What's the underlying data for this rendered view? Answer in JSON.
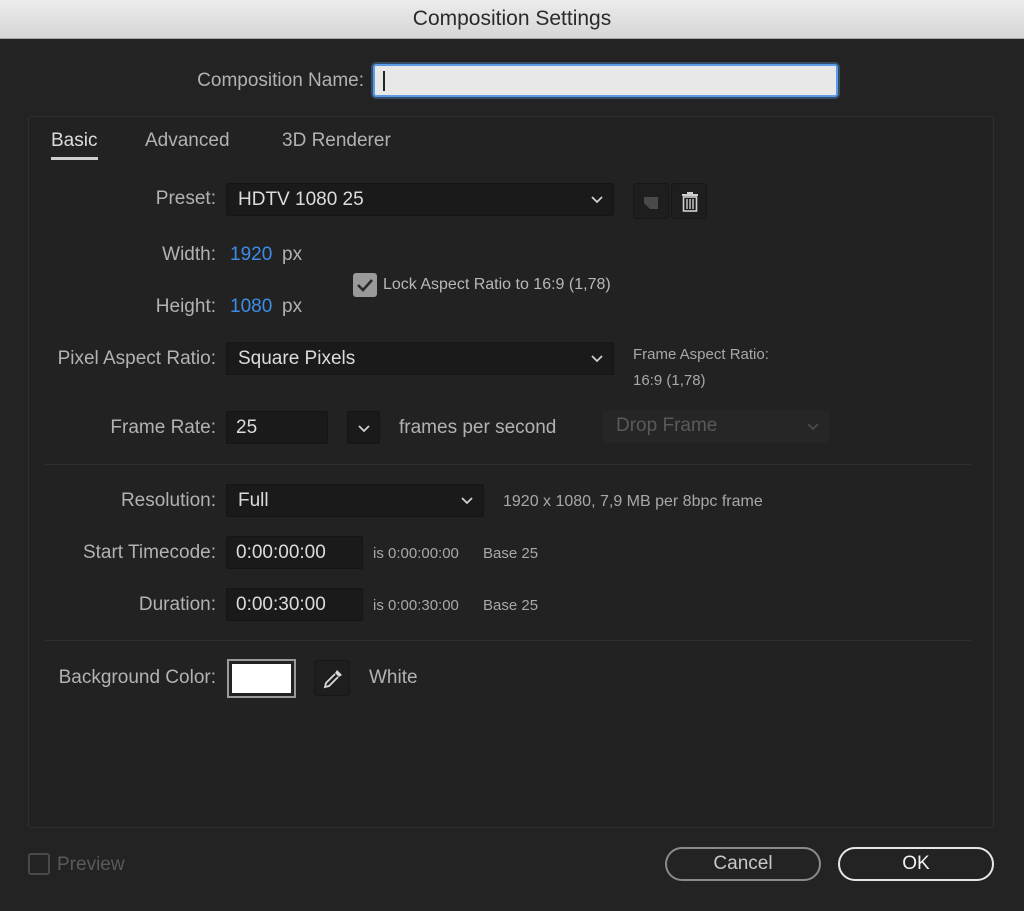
{
  "window": {
    "title": "Composition Settings"
  },
  "comp_name": {
    "label": "Composition Name:",
    "value": ""
  },
  "tabs": [
    {
      "label": "Basic",
      "active": true
    },
    {
      "label": "Advanced",
      "active": false
    },
    {
      "label": "3D Renderer",
      "active": false
    }
  ],
  "preset": {
    "label": "Preset:",
    "value": "HDTV 1080 25",
    "icons": [
      "save-preset-icon",
      "trash-icon"
    ]
  },
  "width": {
    "label": "Width:",
    "value": "1920",
    "unit": "px"
  },
  "height": {
    "label": "Height:",
    "value": "1080",
    "unit": "px"
  },
  "lock_aspect": {
    "label": "Lock Aspect Ratio to 16:9 (1,78)",
    "checked": true
  },
  "pixel_aspect": {
    "label": "Pixel Aspect Ratio:",
    "value": "Square Pixels"
  },
  "frame_aspect": {
    "label": "Frame Aspect Ratio:",
    "value": "16:9 (1,78)"
  },
  "frame_rate": {
    "label": "Frame Rate:",
    "value": "25",
    "unit": "frames per second",
    "drop_frame": "Drop Frame"
  },
  "resolution": {
    "label": "Resolution:",
    "value": "Full",
    "info": "1920 x 1080, 7,9 MB per 8bpc frame"
  },
  "start_timecode": {
    "label": "Start Timecode:",
    "value": "0:00:00:00",
    "is": "is 0:00:00:00",
    "base": "Base 25"
  },
  "duration": {
    "label": "Duration:",
    "value": "0:00:30:00",
    "is": "is 0:00:30:00",
    "base": "Base 25"
  },
  "background": {
    "label": "Background Color:",
    "color": "#ffffff",
    "name": "White"
  },
  "footer": {
    "preview": "Preview",
    "cancel": "Cancel",
    "ok": "OK"
  },
  "colors": {
    "accent_blue": "#3d8ee6",
    "panel": "#232323"
  }
}
